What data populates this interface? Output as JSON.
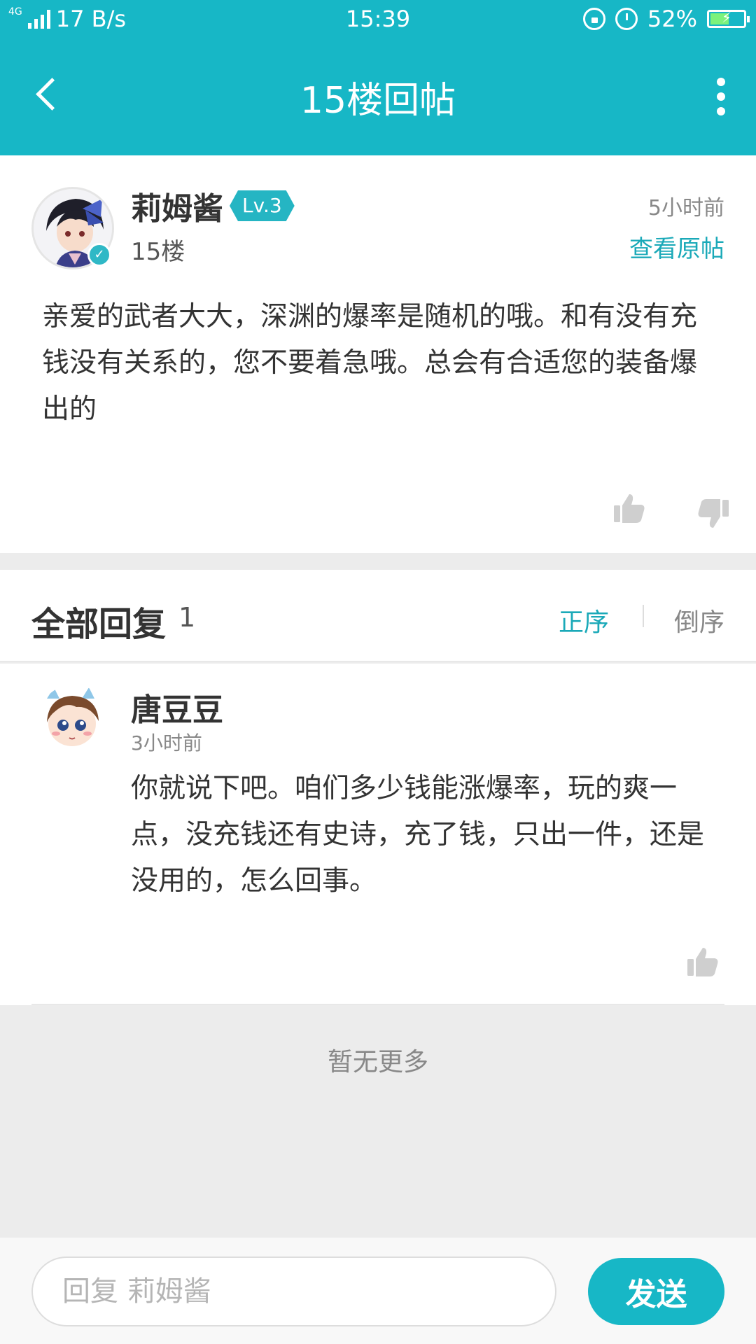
{
  "status_bar": {
    "network": "4G",
    "speed": "17 B/s",
    "time": "15:39",
    "battery": "52%",
    "icons": [
      "signal-icon",
      "lock-rotation-icon",
      "alarm-icon",
      "battery-charging-icon"
    ]
  },
  "header": {
    "title": "15楼回帖",
    "back_icon": "chevron-left-icon",
    "more_icon": "more-vertical-icon"
  },
  "post": {
    "author": "莉姆酱",
    "level": "Lv.3",
    "floor": "15楼",
    "time": "5小时前",
    "view_original": "查看原帖",
    "content": "亲爱的武者大大，深渊的爆率是随机的哦。和有没有充钱没有关系的，您不要着急哦。总会有合适您的装备爆出的",
    "like_icon": "thumbs-up-icon",
    "dislike_icon": "thumbs-down-icon"
  },
  "replies": {
    "title": "全部回复",
    "count": "1",
    "sort_asc": "正序",
    "sort_desc": "倒序",
    "items": [
      {
        "author": "唐豆豆",
        "time": "3小时前",
        "content": "你就说下吧。咱们多少钱能涨爆率，玩的爽一点，没充钱还有史诗，充了钱，只出一件，还是没用的，怎么回事。"
      }
    ],
    "no_more": "暂无更多"
  },
  "composer": {
    "placeholder": "回复 莉姆酱",
    "send_label": "发送"
  },
  "colors": {
    "accent": "#17b7c6",
    "link": "#1aa9b8",
    "background": "#ececec"
  }
}
